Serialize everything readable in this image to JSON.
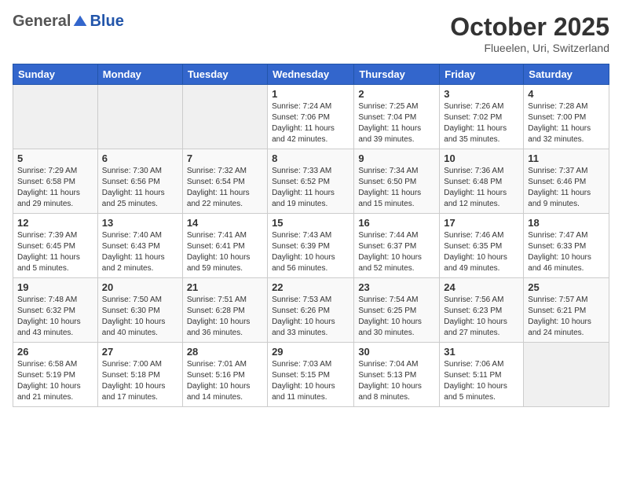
{
  "header": {
    "logo_general": "General",
    "logo_blue": "Blue",
    "month": "October 2025",
    "location": "Flueelen, Uri, Switzerland"
  },
  "weekdays": [
    "Sunday",
    "Monday",
    "Tuesday",
    "Wednesday",
    "Thursday",
    "Friday",
    "Saturday"
  ],
  "weeks": [
    [
      {
        "day": "",
        "info": ""
      },
      {
        "day": "",
        "info": ""
      },
      {
        "day": "",
        "info": ""
      },
      {
        "day": "1",
        "info": "Sunrise: 7:24 AM\nSunset: 7:06 PM\nDaylight: 11 hours\nand 42 minutes."
      },
      {
        "day": "2",
        "info": "Sunrise: 7:25 AM\nSunset: 7:04 PM\nDaylight: 11 hours\nand 39 minutes."
      },
      {
        "day": "3",
        "info": "Sunrise: 7:26 AM\nSunset: 7:02 PM\nDaylight: 11 hours\nand 35 minutes."
      },
      {
        "day": "4",
        "info": "Sunrise: 7:28 AM\nSunset: 7:00 PM\nDaylight: 11 hours\nand 32 minutes."
      }
    ],
    [
      {
        "day": "5",
        "info": "Sunrise: 7:29 AM\nSunset: 6:58 PM\nDaylight: 11 hours\nand 29 minutes."
      },
      {
        "day": "6",
        "info": "Sunrise: 7:30 AM\nSunset: 6:56 PM\nDaylight: 11 hours\nand 25 minutes."
      },
      {
        "day": "7",
        "info": "Sunrise: 7:32 AM\nSunset: 6:54 PM\nDaylight: 11 hours\nand 22 minutes."
      },
      {
        "day": "8",
        "info": "Sunrise: 7:33 AM\nSunset: 6:52 PM\nDaylight: 11 hours\nand 19 minutes."
      },
      {
        "day": "9",
        "info": "Sunrise: 7:34 AM\nSunset: 6:50 PM\nDaylight: 11 hours\nand 15 minutes."
      },
      {
        "day": "10",
        "info": "Sunrise: 7:36 AM\nSunset: 6:48 PM\nDaylight: 11 hours\nand 12 minutes."
      },
      {
        "day": "11",
        "info": "Sunrise: 7:37 AM\nSunset: 6:46 PM\nDaylight: 11 hours\nand 9 minutes."
      }
    ],
    [
      {
        "day": "12",
        "info": "Sunrise: 7:39 AM\nSunset: 6:45 PM\nDaylight: 11 hours\nand 5 minutes."
      },
      {
        "day": "13",
        "info": "Sunrise: 7:40 AM\nSunset: 6:43 PM\nDaylight: 11 hours\nand 2 minutes."
      },
      {
        "day": "14",
        "info": "Sunrise: 7:41 AM\nSunset: 6:41 PM\nDaylight: 10 hours\nand 59 minutes."
      },
      {
        "day": "15",
        "info": "Sunrise: 7:43 AM\nSunset: 6:39 PM\nDaylight: 10 hours\nand 56 minutes."
      },
      {
        "day": "16",
        "info": "Sunrise: 7:44 AM\nSunset: 6:37 PM\nDaylight: 10 hours\nand 52 minutes."
      },
      {
        "day": "17",
        "info": "Sunrise: 7:46 AM\nSunset: 6:35 PM\nDaylight: 10 hours\nand 49 minutes."
      },
      {
        "day": "18",
        "info": "Sunrise: 7:47 AM\nSunset: 6:33 PM\nDaylight: 10 hours\nand 46 minutes."
      }
    ],
    [
      {
        "day": "19",
        "info": "Sunrise: 7:48 AM\nSunset: 6:32 PM\nDaylight: 10 hours\nand 43 minutes."
      },
      {
        "day": "20",
        "info": "Sunrise: 7:50 AM\nSunset: 6:30 PM\nDaylight: 10 hours\nand 40 minutes."
      },
      {
        "day": "21",
        "info": "Sunrise: 7:51 AM\nSunset: 6:28 PM\nDaylight: 10 hours\nand 36 minutes."
      },
      {
        "day": "22",
        "info": "Sunrise: 7:53 AM\nSunset: 6:26 PM\nDaylight: 10 hours\nand 33 minutes."
      },
      {
        "day": "23",
        "info": "Sunrise: 7:54 AM\nSunset: 6:25 PM\nDaylight: 10 hours\nand 30 minutes."
      },
      {
        "day": "24",
        "info": "Sunrise: 7:56 AM\nSunset: 6:23 PM\nDaylight: 10 hours\nand 27 minutes."
      },
      {
        "day": "25",
        "info": "Sunrise: 7:57 AM\nSunset: 6:21 PM\nDaylight: 10 hours\nand 24 minutes."
      }
    ],
    [
      {
        "day": "26",
        "info": "Sunrise: 6:58 AM\nSunset: 5:19 PM\nDaylight: 10 hours\nand 21 minutes."
      },
      {
        "day": "27",
        "info": "Sunrise: 7:00 AM\nSunset: 5:18 PM\nDaylight: 10 hours\nand 17 minutes."
      },
      {
        "day": "28",
        "info": "Sunrise: 7:01 AM\nSunset: 5:16 PM\nDaylight: 10 hours\nand 14 minutes."
      },
      {
        "day": "29",
        "info": "Sunrise: 7:03 AM\nSunset: 5:15 PM\nDaylight: 10 hours\nand 11 minutes."
      },
      {
        "day": "30",
        "info": "Sunrise: 7:04 AM\nSunset: 5:13 PM\nDaylight: 10 hours\nand 8 minutes."
      },
      {
        "day": "31",
        "info": "Sunrise: 7:06 AM\nSunset: 5:11 PM\nDaylight: 10 hours\nand 5 minutes."
      },
      {
        "day": "",
        "info": ""
      }
    ]
  ]
}
